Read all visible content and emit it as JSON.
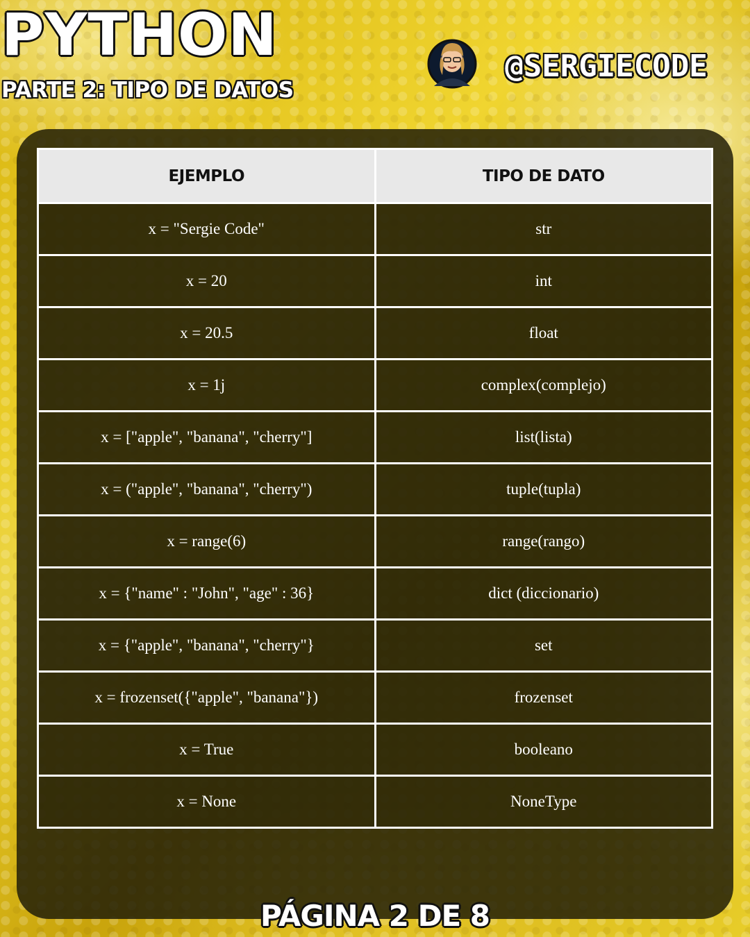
{
  "header": {
    "title": "PYTHON",
    "subtitle": "PARTE 2: TIPO DE DATOS",
    "handle": "@SERGIECODE",
    "avatar_icon": "avatar-icon"
  },
  "table": {
    "columns": [
      "EJEMPLO",
      "TIPO DE DATO"
    ],
    "rows": [
      {
        "example": "x = \"Sergie Code\"",
        "type": "str"
      },
      {
        "example": "x = 20",
        "type": "int"
      },
      {
        "example": "x = 20.5",
        "type": "float"
      },
      {
        "example": "x = 1j",
        "type": "complex(complejo)"
      },
      {
        "example": "x = [\"apple\", \"banana\", \"cherry\"]",
        "type": "list(lista)"
      },
      {
        "example": "x = (\"apple\", \"banana\", \"cherry\")",
        "type": "tuple(tupla)"
      },
      {
        "example": "x = range(6)",
        "type": "range(rango)"
      },
      {
        "example": "x = {\"name\" : \"John\", \"age\" : 36}",
        "type": "dict (diccionario)"
      },
      {
        "example": "x = {\"apple\", \"banana\", \"cherry\"}",
        "type": "set"
      },
      {
        "example": "x = frozenset({\"apple\", \"banana\"})",
        "type": "frozenset"
      },
      {
        "example": "x = True",
        "type": "booleano"
      },
      {
        "example": "x = None",
        "type": "NoneType"
      }
    ]
  },
  "footer": {
    "page_label": "PÁGINA 2 DE 8"
  },
  "colors": {
    "background_yellow": "#e8cd2a",
    "panel_dark": "#232008",
    "header_cell": "#e8e8e8",
    "text_white": "#ffffff"
  }
}
